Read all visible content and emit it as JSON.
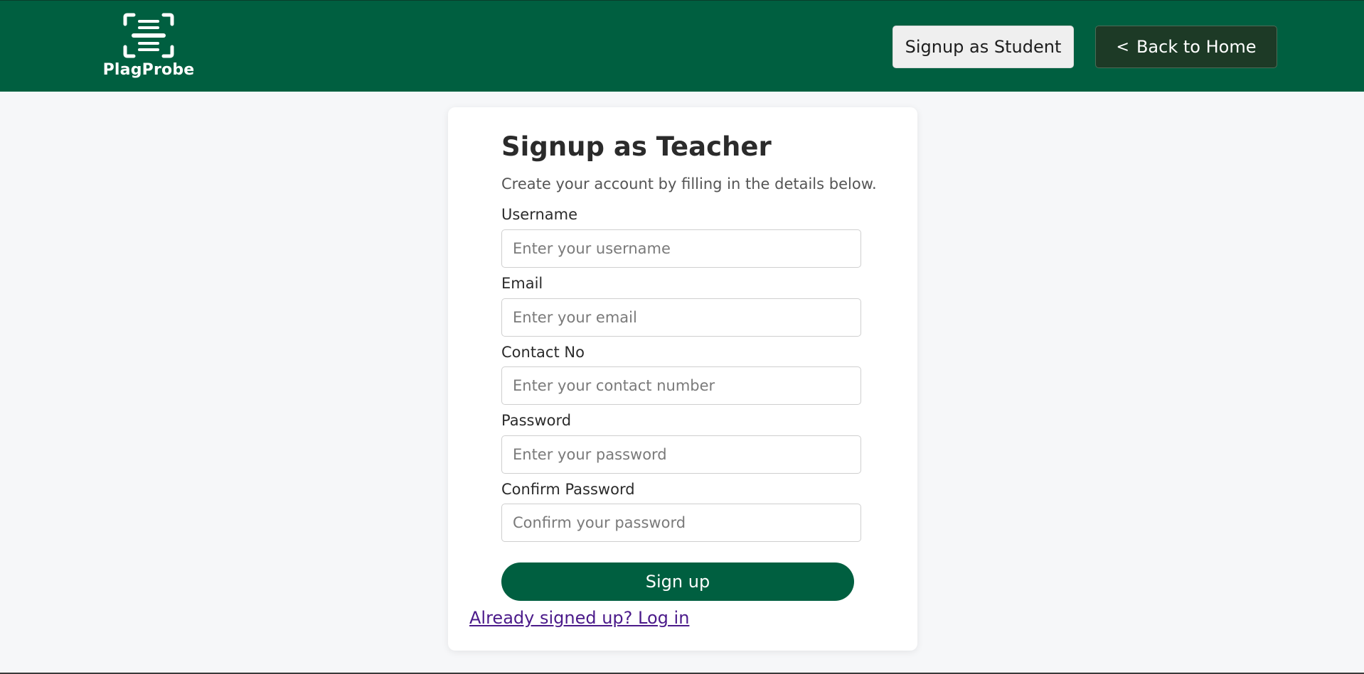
{
  "header": {
    "brand": "PlagProbe",
    "logo_icon": "scan-document-icon",
    "signup_student_label": "Signup as Student",
    "back_home_chevron": "<",
    "back_home_label": "Back to Home",
    "background_color": "#005f40"
  },
  "form": {
    "title": "Signup as Teacher",
    "subtitle": "Create your account by filling in the details below.",
    "fields": [
      {
        "label": "Username",
        "placeholder": "Enter your username",
        "value": ""
      },
      {
        "label": "Email",
        "placeholder": "Enter your email",
        "value": ""
      },
      {
        "label": "Contact No",
        "placeholder": "Enter your contact number",
        "value": ""
      },
      {
        "label": "Password",
        "placeholder": "Enter your password",
        "value": ""
      },
      {
        "label": "Confirm Password",
        "placeholder": "Confirm your password",
        "value": ""
      }
    ],
    "submit_label": "Sign up",
    "login_link": "Already signed up? Log in",
    "accent_color": "#005f40",
    "link_color": "#4b1a8a"
  }
}
